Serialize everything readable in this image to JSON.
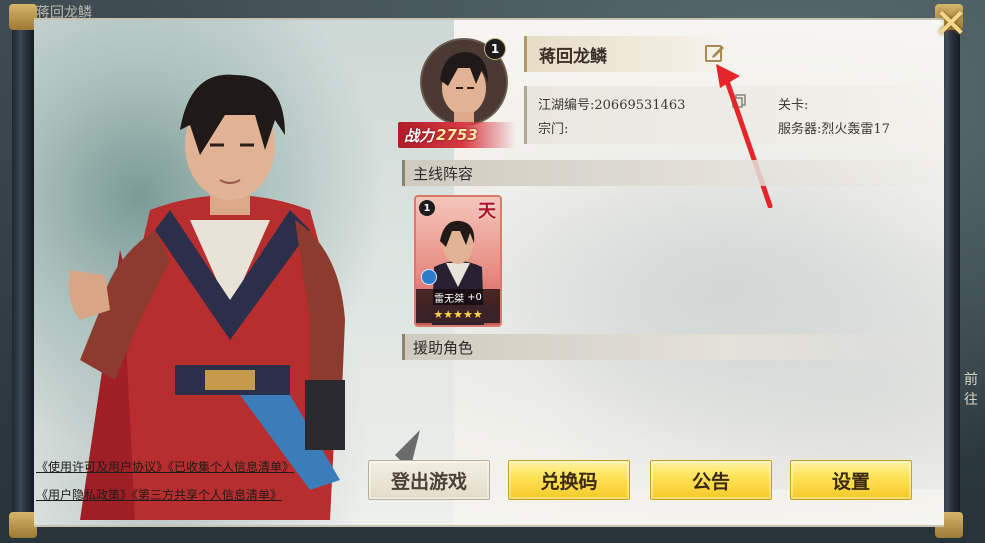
{
  "background_title": "蒋回龙鳞",
  "player": {
    "name": "蒋回龙鳞",
    "level": "1",
    "power_label": "战力",
    "power_value": "2753"
  },
  "info": {
    "jianghu_id_label": "江湖编号:",
    "jianghu_id_value": "20669531463",
    "stage_label": "关卡:",
    "stage_value": "",
    "sect_label": "宗门:",
    "sect_value": "",
    "server_label": "服务器:",
    "server_value": "烈火轰雷17"
  },
  "sections": {
    "main_lineup": "主线阵容",
    "support": "援助角色"
  },
  "lineup_card": {
    "level": "1",
    "rank": "天",
    "name": "雷无桀",
    "plus": "+0",
    "stars": 5
  },
  "links": {
    "line1": "《使用许可及用户协议》《已收集个人信息清单》",
    "line2": "《用户隐私政策》《第三方共享个人信息清单》"
  },
  "buttons": {
    "logout": "登出游戏",
    "redeem": "兑换码",
    "notice": "公告",
    "settings": "设置"
  },
  "side_label": "前往",
  "colors": {
    "accent_yellow": "#ffe35a",
    "power_red": "#d83a44",
    "card_border": "#d97b6a",
    "annotation_red": "#e5252a"
  },
  "icons": {
    "close": "close-icon",
    "edit": "edit-icon",
    "copy": "copy-icon"
  }
}
